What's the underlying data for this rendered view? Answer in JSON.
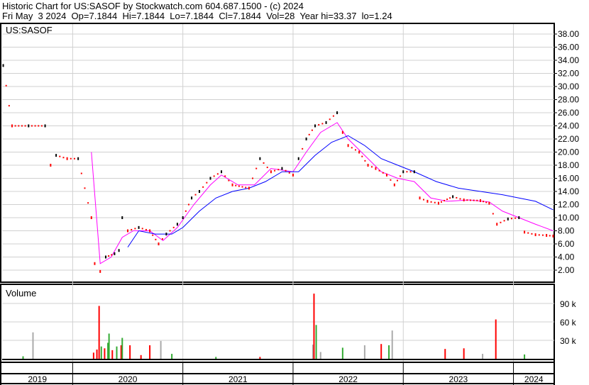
{
  "header": {
    "line1": "Historic Chart for US:SASOF by Stockwatch.com 604.687.1500 - (c) 2024",
    "line2": "Fri May  3 2024  Op=7.1844  Hi=7.1844  Lo=7.1844  Cl=7.1844  Vol=28  Year hi=33.37  lo=1.24"
  },
  "chart_data": [
    {
      "type": "line",
      "title": "US:SASOF",
      "ylim": [
        0,
        39.5
      ],
      "yticks": [
        "2.00",
        "4.00",
        "6.00",
        "8.00",
        "10.00",
        "12.00",
        "14.00",
        "16.00",
        "18.00",
        "20.00",
        "22.00",
        "24.00",
        "26.00",
        "28.00",
        "30.00",
        "32.00",
        "34.00",
        "36.00",
        "38.00"
      ],
      "xlim": [
        2019.36,
        2024.37
      ],
      "xticks": [
        "2019",
        "2020",
        "2021",
        "2022",
        "2023",
        "2024"
      ],
      "series": [
        {
          "name": "price",
          "color": "#ff0000",
          "points": [
            [
              2019.37,
              33.2
            ],
            [
              2019.45,
              24
            ],
            [
              2019.6,
              24
            ],
            [
              2019.75,
              24
            ],
            [
              2019.8,
              18
            ],
            [
              2019.85,
              19.5
            ],
            [
              2019.95,
              19
            ],
            [
              2020.05,
              19
            ],
            [
              2020.17,
              10
            ],
            [
              2020.2,
              3
            ],
            [
              2020.25,
              1.8
            ],
            [
              2020.3,
              4
            ],
            [
              2020.38,
              4.5
            ],
            [
              2020.42,
              5
            ],
            [
              2020.45,
              10
            ],
            [
              2020.5,
              8
            ],
            [
              2020.6,
              8.5
            ],
            [
              2020.7,
              8
            ],
            [
              2020.78,
              6
            ],
            [
              2020.85,
              7.5
            ],
            [
              2020.95,
              9
            ],
            [
              2021.0,
              10
            ],
            [
              2021.08,
              13
            ],
            [
              2021.15,
              14
            ],
            [
              2021.25,
              16
            ],
            [
              2021.35,
              17
            ],
            [
              2021.45,
              15
            ],
            [
              2021.6,
              14.5
            ],
            [
              2021.7,
              19
            ],
            [
              2021.8,
              17
            ],
            [
              2021.9,
              17.5
            ],
            [
              2022.0,
              16.5
            ],
            [
              2022.05,
              19
            ],
            [
              2022.12,
              22
            ],
            [
              2022.2,
              24
            ],
            [
              2022.3,
              24.5
            ],
            [
              2022.4,
              26
            ],
            [
              2022.45,
              23
            ],
            [
              2022.5,
              21
            ],
            [
              2022.6,
              20
            ],
            [
              2022.68,
              18
            ],
            [
              2022.75,
              17.5
            ],
            [
              2022.85,
              16.5
            ],
            [
              2022.92,
              15
            ],
            [
              2023.0,
              17
            ],
            [
              2023.1,
              17
            ],
            [
              2023.15,
              13
            ],
            [
              2023.22,
              12.5
            ],
            [
              2023.32,
              12.2
            ],
            [
              2023.45,
              13.2
            ],
            [
              2023.55,
              12.7
            ],
            [
              2023.7,
              12.6
            ],
            [
              2023.78,
              12.2
            ],
            [
              2023.85,
              9
            ],
            [
              2023.95,
              9.8
            ],
            [
              2024.05,
              10
            ],
            [
              2024.1,
              7.8
            ],
            [
              2024.2,
              7.4
            ],
            [
              2024.3,
              7.3
            ],
            [
              2024.36,
              7.2
            ]
          ]
        },
        {
          "name": "short MA",
          "color": "#ff00ff",
          "points": [
            [
              2020.17,
              20
            ],
            [
              2020.25,
              3
            ],
            [
              2020.35,
              4
            ],
            [
              2020.45,
              7
            ],
            [
              2020.55,
              8
            ],
            [
              2020.7,
              8
            ],
            [
              2020.82,
              6.5
            ],
            [
              2020.95,
              8.5
            ],
            [
              2021.1,
              12
            ],
            [
              2021.25,
              15
            ],
            [
              2021.35,
              16.5
            ],
            [
              2021.5,
              15
            ],
            [
              2021.65,
              15
            ],
            [
              2021.8,
              17.5
            ],
            [
              2022.0,
              17
            ],
            [
              2022.12,
              20
            ],
            [
              2022.25,
              23
            ],
            [
              2022.4,
              24.5
            ],
            [
              2022.5,
              22
            ],
            [
              2022.65,
              19.5
            ],
            [
              2022.8,
              17
            ],
            [
              2022.95,
              16
            ],
            [
              2023.1,
              15.5
            ],
            [
              2023.25,
              13
            ],
            [
              2023.4,
              12.5
            ],
            [
              2023.6,
              12.7
            ],
            [
              2023.78,
              12.4
            ],
            [
              2023.9,
              11
            ],
            [
              2024.05,
              10
            ],
            [
              2024.2,
              9
            ],
            [
              2024.36,
              8
            ]
          ]
        },
        {
          "name": "long MA",
          "color": "#0000ff",
          "points": [
            [
              2020.5,
              5.5
            ],
            [
              2020.6,
              8
            ],
            [
              2020.75,
              7.5
            ],
            [
              2020.9,
              7.5
            ],
            [
              2021.0,
              8.5
            ],
            [
              2021.15,
              11
            ],
            [
              2021.3,
              13
            ],
            [
              2021.45,
              14
            ],
            [
              2021.6,
              14.5
            ],
            [
              2021.75,
              15.5
            ],
            [
              2021.9,
              17
            ],
            [
              2022.05,
              17
            ],
            [
              2022.2,
              19.5
            ],
            [
              2022.35,
              21.5
            ],
            [
              2022.5,
              22.5
            ],
            [
              2022.65,
              21
            ],
            [
              2022.8,
              19
            ],
            [
              2022.95,
              18
            ],
            [
              2023.1,
              17
            ],
            [
              2023.3,
              15.5
            ],
            [
              2023.5,
              14.5
            ],
            [
              2023.7,
              14
            ],
            [
              2023.9,
              13.5
            ],
            [
              2024.05,
              13
            ],
            [
              2024.2,
              12.5
            ],
            [
              2024.36,
              11.2
            ]
          ]
        }
      ]
    },
    {
      "type": "bar",
      "title": "Volume",
      "ylim": [
        0,
        120
      ],
      "yticks": [
        "30 k",
        "60 k",
        "90 k"
      ],
      "unit": "k",
      "bars": [
        [
          2019.55,
          4,
          "g"
        ],
        [
          2019.64,
          43,
          "s"
        ],
        [
          2020.19,
          10,
          "r"
        ],
        [
          2020.22,
          15,
          "r"
        ],
        [
          2020.24,
          86,
          "r"
        ],
        [
          2020.26,
          20,
          "g"
        ],
        [
          2020.29,
          17,
          "r"
        ],
        [
          2020.32,
          26,
          "g"
        ],
        [
          2020.33,
          41,
          "g"
        ],
        [
          2020.36,
          14,
          "r"
        ],
        [
          2020.4,
          20,
          "g"
        ],
        [
          2020.44,
          22,
          "r"
        ],
        [
          2020.45,
          34,
          "g"
        ],
        [
          2020.52,
          22,
          "r"
        ],
        [
          2020.62,
          6,
          "r"
        ],
        [
          2020.7,
          22,
          "r"
        ],
        [
          2020.8,
          29,
          "s"
        ],
        [
          2020.9,
          8,
          "g"
        ],
        [
          2021.3,
          3,
          "g"
        ],
        [
          2021.7,
          3,
          "r"
        ],
        [
          2022.18,
          23,
          "s"
        ],
        [
          2022.19,
          106,
          "r"
        ],
        [
          2022.21,
          55,
          "g"
        ],
        [
          2022.25,
          11,
          "s"
        ],
        [
          2022.45,
          18,
          "g"
        ],
        [
          2022.65,
          22,
          "s"
        ],
        [
          2022.8,
          24,
          "r"
        ],
        [
          2022.87,
          22,
          "g"
        ],
        [
          2022.9,
          46,
          "s"
        ],
        [
          2023.38,
          16,
          "r"
        ],
        [
          2023.55,
          17,
          "r"
        ],
        [
          2023.72,
          8,
          "s"
        ],
        [
          2023.84,
          64,
          "r"
        ],
        [
          2024.1,
          7,
          "g"
        ]
      ]
    }
  ]
}
